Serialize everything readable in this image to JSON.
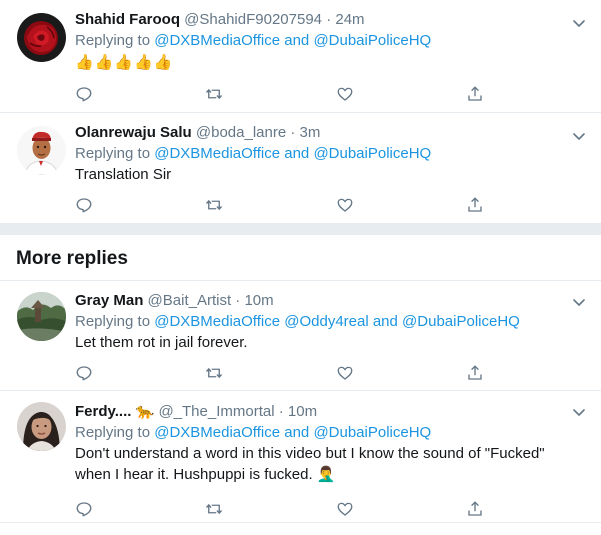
{
  "tweets_top": [
    {
      "name": "Shahid Farooq",
      "handle": "@ShahidF90207594",
      "dot": "·",
      "time": "24m",
      "replying_prefix": "Replying to ",
      "reply_to_1": "@DXBMediaOffice",
      "reply_and": " and ",
      "reply_to_2": "@DubaiPoliceHQ",
      "text_emoji": "👍👍👍👍👍",
      "avatar": "red-rose-avatar"
    },
    {
      "name": "Olanrewaju Salu",
      "handle": "@boda_lanre",
      "dot": "·",
      "time": "3m",
      "replying_prefix": "Replying to ",
      "reply_to_1": "@DXBMediaOffice",
      "reply_and": " and ",
      "reply_to_2": "@DubaiPoliceHQ",
      "text": "Translation Sir",
      "avatar": "cartoon-man-avatar"
    }
  ],
  "more_replies": {
    "heading": "More replies"
  },
  "tweets_bottom": [
    {
      "name": "Gray Man",
      "handle": "@Bait_Artist",
      "dot": "·",
      "time": "10m",
      "replying_prefix": "Replying to ",
      "reply_to_1": "@DXBMediaOffice",
      "reply_mid": " ",
      "reply_to_2": "@Oddy4real",
      "reply_and": " and ",
      "reply_to_3": "@DubaiPoliceHQ",
      "text": "Let them rot in jail forever.",
      "avatar": "landscape-avatar"
    },
    {
      "name": "Ferdy....",
      "name_emoji": "🐆",
      "handle": "@_The_Immortal",
      "dot": "·",
      "time": "10m",
      "replying_prefix": "Replying to ",
      "reply_to_1": "@DXBMediaOffice",
      "reply_and": " and ",
      "reply_to_2": "@DubaiPoliceHQ",
      "text_line1": "Don't understand a word in this video but I know the sound of \"Fucked\"",
      "text_line2": "when I hear it. Hushpuppi is fucked. ",
      "text_emoji": "🤦‍♂️",
      "avatar": "woman-photo-avatar"
    }
  ],
  "icons": {
    "reply": "reply-icon",
    "retweet": "retweet-icon",
    "like": "like-icon",
    "share": "share-icon",
    "more": "chevron-down-icon"
  },
  "colors": {
    "link": "#1b95e0",
    "secondary": "#657786",
    "divider": "#e6ecf0"
  }
}
